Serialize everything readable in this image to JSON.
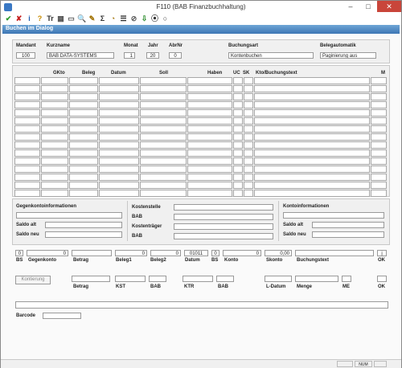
{
  "window": {
    "title": "F110 (BAB Finanzbuchhaltung)",
    "minimize": "–",
    "maximize": "□",
    "close": "✕"
  },
  "toolbar": {
    "icons": [
      "✔",
      "✘",
      "i",
      "?",
      "Tr",
      "▦",
      "▭",
      "🔍",
      "✎",
      "Σ",
      "◔",
      "☰",
      "⊘",
      "⇩",
      "⦿",
      "○"
    ]
  },
  "band": {
    "title": "Buchen im Dialog"
  },
  "header": {
    "mandant_label": "Mandant",
    "mandant_value": "100",
    "kurzname_label": "Kurzname",
    "kurzname_value": "BAB DATA-SYSTEMS",
    "monat_label": "Monat",
    "monat_value": "1",
    "jahr_label": "Jahr",
    "jahr_value": "20",
    "abrnr_label": "AbrNr",
    "abrnr_value": "0",
    "buchungsart_label": "Buchungsart",
    "buchungsart_value": "Kontenbuchen",
    "belegautomatik_label": "Belegautomatik",
    "belegautomatik_value": "Paginierung aus"
  },
  "grid": {
    "columns": [
      "GKto",
      "Beleg",
      "Datum",
      "Soll",
      "Haben",
      "UC",
      "SK",
      "Kto/Buchungstext",
      "M"
    ]
  },
  "info": {
    "gegenkonto_title": "Gegenkontoinformationen",
    "saldo_alt": "Saldo alt",
    "saldo_neu": "Saldo neu",
    "kostenstelle": "Kostenstelle",
    "bab1": "BAB",
    "kostentraeger": "Kostenträger",
    "bab2": "BAB",
    "konto_title": "Kontoinformationen",
    "konto_saldo_alt": "Saldo alt",
    "konto_saldo_neu": "Saldo neu"
  },
  "entry": {
    "bs_value": "0",
    "gegenkonto_value": "0",
    "beleg1_value": "0",
    "beleg2_value": "0",
    "datum_value": "01011",
    "bs2_value": "0",
    "konto_value": "0",
    "skonto_value": "0,00",
    "ok_value": "j",
    "labels": {
      "bs": "BS",
      "gegenkonto": "Gegenkonto",
      "betrag": "Betrag",
      "beleg1": "Beleg1",
      "beleg2": "Beleg2",
      "datum": "Datum",
      "bs2": "BS",
      "konto": "Konto",
      "skonto": "Skonto",
      "buchungstext": "Buchungstext",
      "ok": "OK"
    }
  },
  "kontierung": {
    "button": "Kontierung",
    "labels": {
      "betrag": "Betrag",
      "kst": "KST",
      "bab1": "BAB",
      "ktr": "KTR",
      "bab2": "BAB",
      "ldatum": "L-Datum",
      "menge": "Menge",
      "me": "ME",
      "ok": "OK"
    }
  },
  "barcode": {
    "label": "Barcode"
  },
  "statusbar": {
    "num": "NUM"
  }
}
